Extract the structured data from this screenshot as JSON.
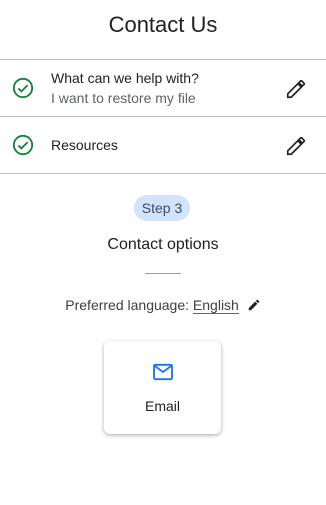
{
  "header": {
    "title": "Contact Us"
  },
  "steps": [
    {
      "title": "What can we help with?",
      "answer": "I want to restore my file",
      "status_icon": "check-circle-icon",
      "edit_icon": "pencil-icon"
    },
    {
      "title": "Resources",
      "answer": "",
      "status_icon": "check-circle-icon",
      "edit_icon": "pencil-icon"
    }
  ],
  "current_step": {
    "badge": "Step 3",
    "title": "Contact options",
    "language_label": "Preferred language:",
    "language_value": "English",
    "options": [
      {
        "label": "Email",
        "icon": "mail-icon"
      }
    ]
  },
  "colors": {
    "check_green": "#188038",
    "accent_blue": "#1a73e8",
    "badge_bg": "#d2e3fc"
  }
}
